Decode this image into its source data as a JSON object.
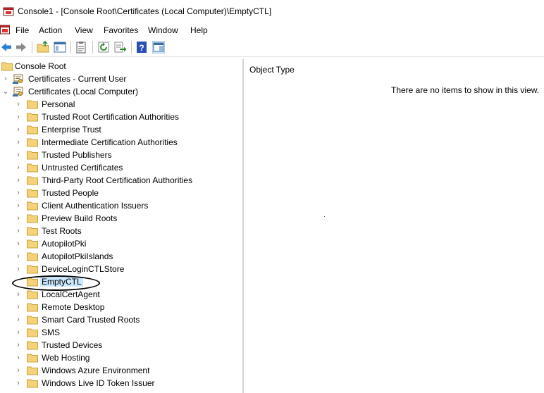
{
  "window": {
    "title": "Console1 - [Console Root\\Certificates (Local Computer)\\EmptyCTL]"
  },
  "menu": {
    "items": [
      {
        "label": "File"
      },
      {
        "label": "Action"
      },
      {
        "label": "View"
      },
      {
        "label": "Favorites"
      },
      {
        "label": "Window"
      },
      {
        "label": "Help"
      }
    ]
  },
  "toolbar": {
    "buttons": [
      {
        "icon": "back-arrow-icon"
      },
      {
        "icon": "forward-arrow-icon"
      },
      {
        "icon": "up-folder-icon"
      },
      {
        "icon": "show-hide-tree-icon"
      },
      {
        "icon": "properties-icon"
      },
      {
        "icon": "refresh-icon"
      },
      {
        "icon": "export-list-icon"
      },
      {
        "icon": "help-icon"
      },
      {
        "icon": "show-hide-action-pane-icon"
      }
    ]
  },
  "tree": {
    "root": {
      "label": "Console Root"
    },
    "current_user": {
      "label": "Certificates - Current User"
    },
    "local_computer": {
      "label": "Certificates (Local Computer)"
    },
    "stores": [
      {
        "label": "Personal"
      },
      {
        "label": "Trusted Root Certification Authorities"
      },
      {
        "label": "Enterprise Trust"
      },
      {
        "label": "Intermediate Certification Authorities"
      },
      {
        "label": "Trusted Publishers"
      },
      {
        "label": "Untrusted Certificates"
      },
      {
        "label": "Third-Party Root Certification Authorities"
      },
      {
        "label": "Trusted People"
      },
      {
        "label": "Client Authentication Issuers"
      },
      {
        "label": "Preview Build Roots"
      },
      {
        "label": "Test Roots"
      },
      {
        "label": "AutopilotPki"
      },
      {
        "label": "AutopilotPkiIslands"
      },
      {
        "label": "DeviceLoginCTLStore"
      },
      {
        "label": "EmptyCTL"
      },
      {
        "label": "LocalCertAgent"
      },
      {
        "label": "Remote Desktop"
      },
      {
        "label": "Smart Card Trusted Roots"
      },
      {
        "label": "SMS"
      },
      {
        "label": "Trusted Devices"
      },
      {
        "label": "Web Hosting"
      },
      {
        "label": "Windows Azure Environment"
      },
      {
        "label": "Windows Live ID Token Issuer"
      }
    ],
    "selected": "EmptyCTL"
  },
  "detail": {
    "column_header": "Object Type",
    "empty_message": "There are no items to show in this view."
  },
  "colors": {
    "selection": "#cce8ff",
    "folder": "#f4d27a",
    "expander": "#6e6e6e"
  }
}
